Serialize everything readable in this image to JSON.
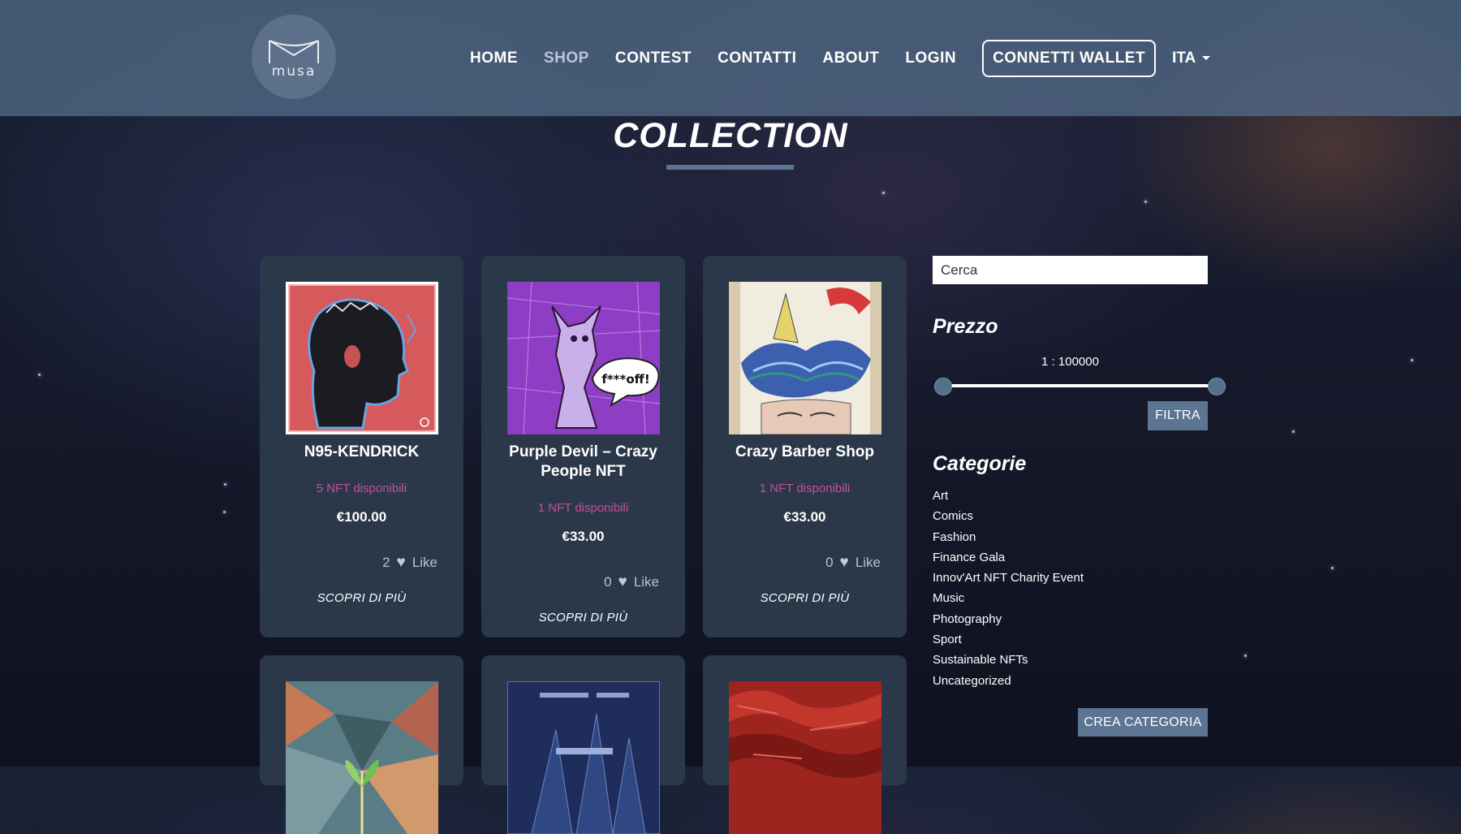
{
  "brand": {
    "logo_text": "musa"
  },
  "nav": {
    "items": [
      {
        "label": "HOME",
        "active": false
      },
      {
        "label": "SHOP",
        "active": true
      },
      {
        "label": "CONTEST",
        "active": false
      },
      {
        "label": "CONTATTI",
        "active": false
      },
      {
        "label": "ABOUT",
        "active": false
      },
      {
        "label": "LOGIN",
        "active": false
      }
    ],
    "wallet_label": "CONNETTI WALLET",
    "language": "ITA"
  },
  "page_title": "COLLECTION",
  "products": [
    {
      "name": "N95-KENDRICK",
      "availability": "5 NFT disponibili",
      "price": "€100.00",
      "likes": "2",
      "like_label": "Like",
      "more_label": "SCOPRI DI PIÙ"
    },
    {
      "name": "Purple Devil – Crazy People NFT",
      "availability": "1 NFT disponibili",
      "price": "€33.00",
      "likes": "0",
      "like_label": "Like",
      "more_label": "SCOPRI DI PIÙ",
      "bubble_text": "f***off!"
    },
    {
      "name": "Crazy Barber Shop",
      "availability": "1 NFT disponibili",
      "price": "€33.00",
      "likes": "0",
      "like_label": "Like",
      "more_label": "SCOPRI DI PIÙ"
    }
  ],
  "sidebar": {
    "search_placeholder": "Cerca",
    "price_heading": "Prezzo",
    "price_range_label": "1 : 100000",
    "price_range": {
      "min": 1,
      "max": 100000
    },
    "filter_label": "FILTRA",
    "categories_heading": "Categorie",
    "categories": [
      "Art",
      "Comics",
      "Fashion",
      "Finance Gala",
      "Innov'Art NFT Charity Event",
      "Music",
      "Photography",
      "Sport",
      "Sustainable NFTs",
      "Uncategorized"
    ],
    "create_category_label": "CREA CATEGORIA"
  },
  "colors": {
    "header_bg": "#526986",
    "card_bg": "#2b3849",
    "availability": "#c64e9c",
    "button": "#5b7592"
  }
}
